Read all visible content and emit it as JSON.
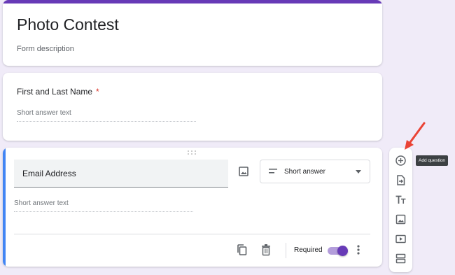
{
  "form": {
    "title": "Photo Contest",
    "description": "Form description"
  },
  "questions": [
    {
      "title": "First and Last Name",
      "required_mark": "*",
      "answer_placeholder": "Short answer text"
    },
    {
      "title": "Email Address",
      "type": "Short answer",
      "answer_placeholder": "Short answer text",
      "required_label": "Required",
      "required": true
    }
  ],
  "toolbar": {
    "tooltip": "Add question",
    "tools": [
      "add-question-icon",
      "import-questions-icon",
      "add-title-icon",
      "add-image-icon",
      "add-video-icon",
      "add-section-icon"
    ]
  },
  "colors": {
    "accent": "#673ab7",
    "active_bar": "#4285f4",
    "background": "#f0ebf8",
    "required_star": "#d93025",
    "annotation_arrow": "#ea4335"
  }
}
